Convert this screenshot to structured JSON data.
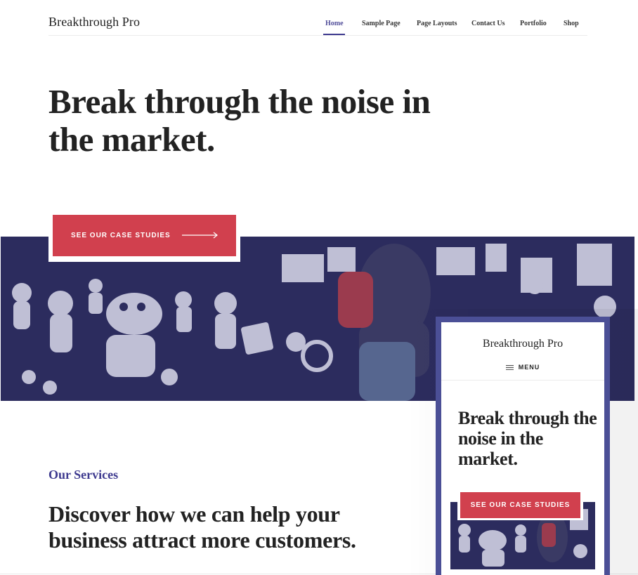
{
  "header": {
    "site_title": "Breakthrough Pro",
    "nav": [
      "Home",
      "Sample Page",
      "Page Layouts",
      "Contact Us",
      "Portfolio",
      "Shop"
    ],
    "active_nav": "Home"
  },
  "hero": {
    "title": "Break through the noise in the market.",
    "cta_label": "SEE OUR CASE STUDIES"
  },
  "services": {
    "label": "Our Services",
    "heading": "Discover how we can help your business attract more customers."
  },
  "mobile_preview": {
    "site_title": "Breakthrough Pro",
    "menu_label": "MENU",
    "hero_title": "Break through the noise in the market.",
    "cta_label": "SEE OUR CASE STUDIES"
  },
  "colors": {
    "accent": "#3e3a8f",
    "cta": "#d1404e",
    "image_tint": "#2c2c5e",
    "device_frame": "#4b4f96"
  },
  "icons": [
    "arrow-right-icon",
    "hamburger-menu-icon"
  ]
}
